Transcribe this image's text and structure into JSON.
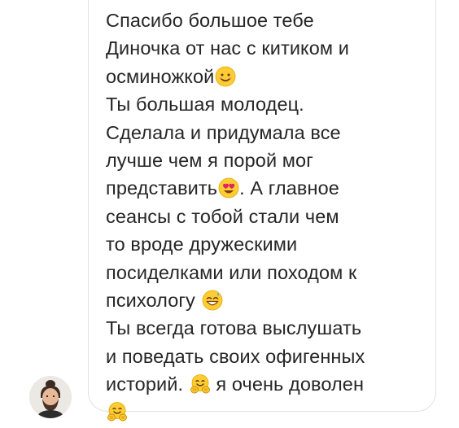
{
  "message": {
    "lines": [
      {
        "text": "Спасибо большое тебе",
        "emoji": null,
        "after": ""
      },
      {
        "text": "Диночка от нас с китиком и",
        "emoji": null,
        "after": ""
      },
      {
        "text": "осминожкой",
        "emoji": "smiling-face-icon",
        "after": ""
      },
      {
        "text": "Ты большая молодец.",
        "emoji": null,
        "after": ""
      },
      {
        "text": "Сделала и придумала все",
        "emoji": null,
        "after": ""
      },
      {
        "text": "лучше чем я порой мог",
        "emoji": null,
        "after": ""
      },
      {
        "text": "представить",
        "emoji": "heart-eyes-icon",
        "after": ". А главное"
      },
      {
        "text": "сеансы с тобой стали чем",
        "emoji": null,
        "after": ""
      },
      {
        "text": "то вроде дружескими",
        "emoji": null,
        "after": ""
      },
      {
        "text": "посиделками или походом к",
        "emoji": null,
        "after": ""
      },
      {
        "text": "психологу ",
        "emoji": "grinning-sweat-icon",
        "after": ""
      },
      {
        "text": "Ты всегда готова выслушать",
        "emoji": null,
        "after": ""
      },
      {
        "text": "и поведать своих офигенных",
        "emoji": null,
        "after": ""
      },
      {
        "text": "историй. ",
        "emoji": "hugging-face-icon",
        "after": " я очень доволен"
      },
      {
        "text": "",
        "emoji": "hugging-face-icon",
        "after": ""
      }
    ]
  },
  "sender": {
    "avatar_icon": "profile-photo"
  },
  "colors": {
    "text": "#262626",
    "bubble_border": "#e2e2e2",
    "background": "#ffffff",
    "emoji_face": "#ffcc33"
  }
}
